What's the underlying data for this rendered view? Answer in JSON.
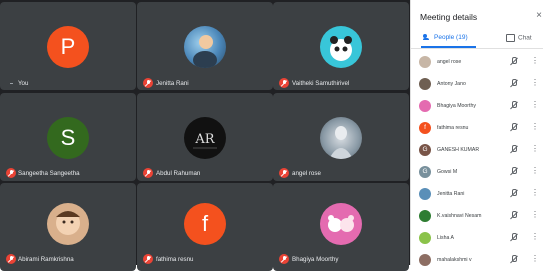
{
  "panel": {
    "title": "Meeting details",
    "close_glyph": "×",
    "tab_people": "People (19)",
    "tab_chat": "Chat",
    "more_glyph": "⋮",
    "participants": [
      {
        "name": "angel rose",
        "initial": "",
        "color": "#c7b6a6"
      },
      {
        "name": "Antony Jano",
        "initial": "",
        "color": "#6f5f52"
      },
      {
        "name": "Bhagiya Moorthy",
        "initial": "",
        "color": "#e46bb0"
      },
      {
        "name": "fathima resnu",
        "initial": "f",
        "color": "#f4511e"
      },
      {
        "name": "GANESH KUMAR",
        "initial": "G",
        "color": "#795548"
      },
      {
        "name": "Gowsi M",
        "initial": "G",
        "color": "#78909c"
      },
      {
        "name": "Jenitta Rani",
        "initial": "",
        "color": "#5a8fb8"
      },
      {
        "name": "K.vaishnavi Nesam",
        "initial": "",
        "color": "#2e7d32"
      },
      {
        "name": "Lisha A",
        "initial": "",
        "color": "#8bc34a"
      },
      {
        "name": "mahalakshmi v",
        "initial": "",
        "color": "#8d6e63"
      }
    ]
  },
  "tiles": [
    {
      "name": "You",
      "initial": "P",
      "color": "#f4511e",
      "photo": false
    },
    {
      "name": "Jenitta Rani",
      "initial": "",
      "color": "#4a86b8",
      "photo": true
    },
    {
      "name": "Vaitheki Samuthirivel",
      "initial": "",
      "color": "#38c6d9",
      "photo": true
    },
    {
      "name": "Sangeetha Sangeetha",
      "initial": "S",
      "color": "#33691e",
      "photo": false
    },
    {
      "name": "Abdul Rahuman",
      "initial": "",
      "color": "#111111",
      "photo": true
    },
    {
      "name": "angel rose",
      "initial": "",
      "color": "#8a9aa6",
      "photo": true
    },
    {
      "name": "Abirami Ramkrishna",
      "initial": "",
      "color": "#d9b08c",
      "photo": true
    },
    {
      "name": "fathima resnu",
      "initial": "f",
      "color": "#f4511e",
      "photo": false
    },
    {
      "name": "Bhagiya Moorthy",
      "initial": "",
      "color": "#e46bb0",
      "photo": true
    }
  ]
}
